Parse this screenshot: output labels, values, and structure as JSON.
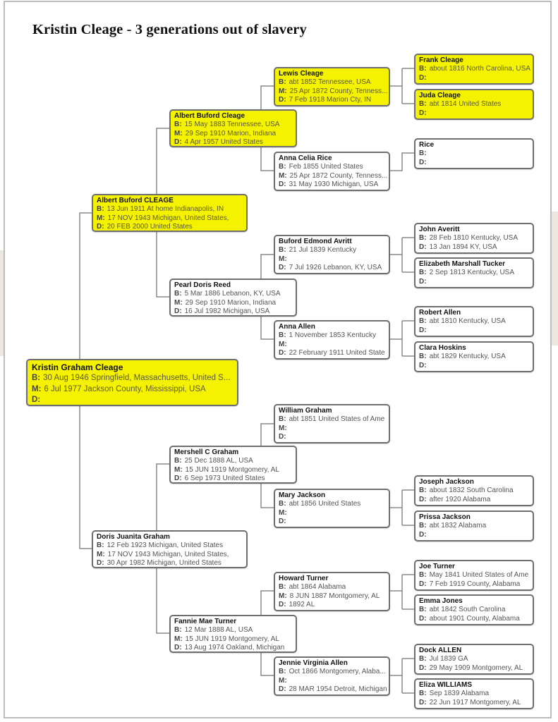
{
  "title": "Kristin Cleage - 3 generations out of slavery",
  "colors": {
    "highlight": "#f5f200",
    "border": "#6e6e6e",
    "line": "#8a8a8a"
  },
  "labels": {
    "birth": "B:",
    "marriage": "M:",
    "death": "D:"
  },
  "root": {
    "name": "Kristin Graham Cleage",
    "b": "30 Aug 1946 Springfield, Massachusetts, United S...",
    "m": "6 Jul 1977 Jackson County, Mississippi, USA",
    "d": ""
  },
  "gen1": [
    {
      "name": "Albert Buford CLEAGE",
      "b": "13 Jun 1911 At home Indianapolis, IN",
      "m": "17 NOV 1943 Michigan, United States,",
      "d": "20 FEB 2000 United States"
    },
    {
      "name": "Doris Juanita Graham",
      "b": "12 Feb 1923 Michigan, United States",
      "m": "17 NOV 1943 Michigan, United States,",
      "d": "30 Apr 1982 Michigan, United States"
    }
  ],
  "gen2": [
    {
      "name": "Albert Buford Cleage",
      "b": "15 May 1883 Tennessee, USA",
      "m": "29 Sep 1910 Marion, Indiana",
      "d": "4 Apr 1957 United States"
    },
    {
      "name": "Pearl Doris Reed",
      "b": "5 Mar 1886 Lebanon, KY, USA",
      "m": "29 Sep 1910 Marion, Indiana",
      "d": "16 Jul 1982 Michigan, USA"
    },
    {
      "name": "Mershell C Graham",
      "b": "25 Dec 1888 AL, USA",
      "m": "15 JUN 1919 Montgomery, AL",
      "d": "6 Sep 1973 United States"
    },
    {
      "name": "Fannie Mae Turner",
      "b": "12 Mar 1888 AL, USA",
      "m": "15 JUN 1919 Montgomery, AL",
      "d": "13 Aug 1974 Oakland, Michigan"
    }
  ],
  "gen3": [
    {
      "name": "Lewis Cleage",
      "b": "abt 1852 Tennessee, USA",
      "m": "25 Apr 1872 County, Tenness...",
      "d": "7 Feb 1918 Marion Cty, IN"
    },
    {
      "name": "Anna Celia Rice",
      "b": "Feb 1855 United States",
      "m": "25 Apr 1872 County, Tenness...",
      "d": "31 May 1930 Michigan, USA"
    },
    {
      "name": "Buford Edmond Avritt",
      "b": "21 Jul 1839 Kentucky",
      "m": "",
      "d": "7 Jul 1926 Lebanon, KY, USA"
    },
    {
      "name": "Anna Allen",
      "b": "1 November 1853 Kentucky",
      "m": "",
      "d": "22 February 1911 United State"
    },
    {
      "name": "William Graham",
      "b": "abt 1851 United States of Ame",
      "m": "",
      "d": ""
    },
    {
      "name": "Mary Jackson",
      "b": "abt 1856 United States",
      "m": "",
      "d": ""
    },
    {
      "name": "Howard Turner",
      "b": "abt 1864 Alabama",
      "m": "8 JUN 1887 Montgomery, AL",
      "d": "1892 AL"
    },
    {
      "name": "Jennie Virginia Allen",
      "b": "Oct 1866 Montgomery, Alaba...",
      "m": "",
      "d": "28 MAR 1954 Detroit, Michigan"
    }
  ],
  "gen4": [
    {
      "name": "Frank Cleage",
      "b": "about 1816 North Carolina, USA",
      "d": ""
    },
    {
      "name": "Juda Cleage",
      "b": "abt 1814 United States",
      "d": ""
    },
    {
      "name": "Rice",
      "b": "",
      "d": ""
    },
    {
      "name": "John Averitt",
      "b": "28 Feb 1810 Kentucky, USA",
      "d": "13 Jan 1894 KY, USA"
    },
    {
      "name": "Elizabeth Marshall Tucker",
      "b": "2 Sep 1813 Kentucky, USA",
      "d": ""
    },
    {
      "name": "Robert Allen",
      "b": "abt 1810 Kentucky, USA",
      "d": ""
    },
    {
      "name": "Clara Hoskins",
      "b": "abt 1829 Kentucky, USA",
      "d": ""
    },
    {
      "name": "Joseph Jackson",
      "b": "about 1832 South Carolina",
      "d": "after 1920 Alabama"
    },
    {
      "name": "Prissa Jackson",
      "b": "abt 1832 Alabama",
      "d": ""
    },
    {
      "name": "Joe Turner",
      "b": "May 1841 United States of Ame",
      "d": "7 Feb 1919 County, Alabama"
    },
    {
      "name": "Emma Jones",
      "b": "abt 1842 South Carolina",
      "d": "about 1901 County, Alabama"
    },
    {
      "name": "Dock ALLEN",
      "b": "Jul 1839 GA",
      "d": "29 May 1909 Montgomery, AL"
    },
    {
      "name": "Eliza WILLIAMS",
      "b": "Sep 1839 Alabama",
      "d": "22 Jun 1917 Montgomery, AL"
    }
  ]
}
